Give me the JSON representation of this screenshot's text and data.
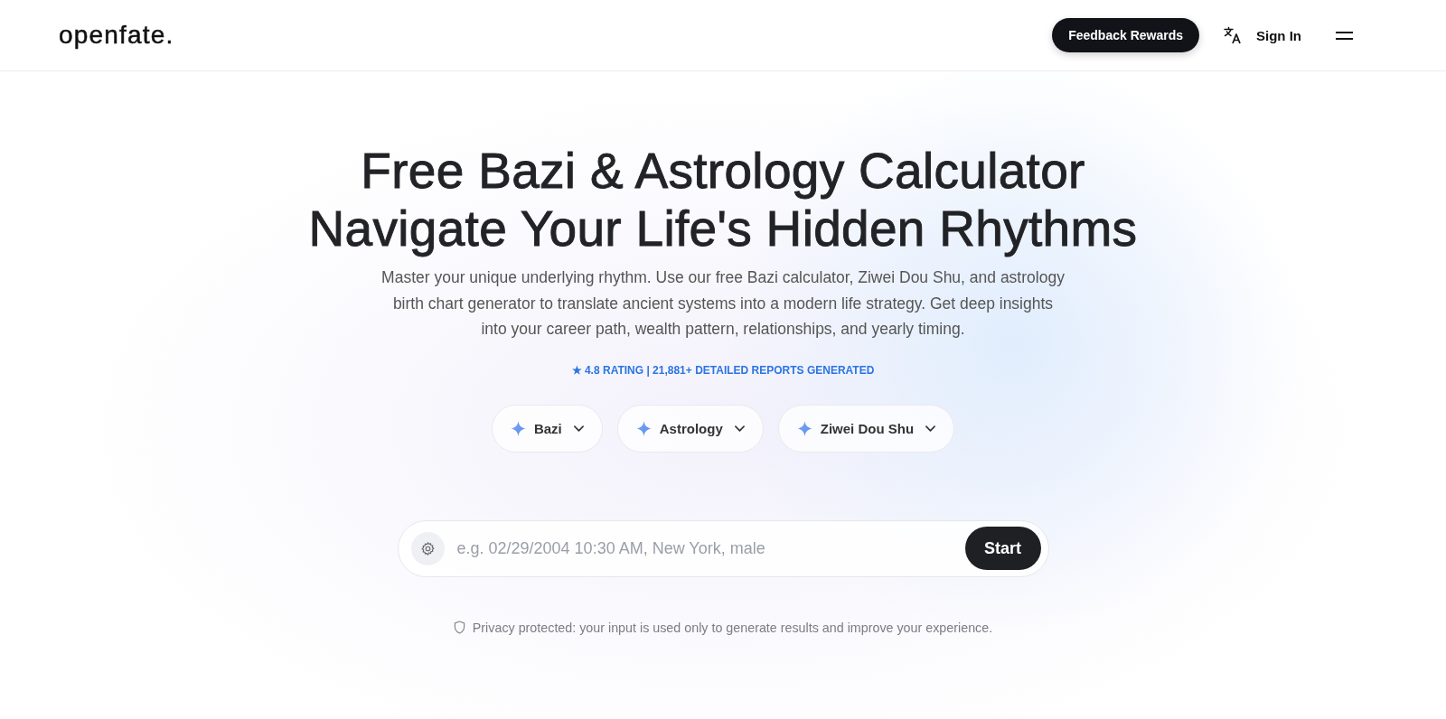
{
  "header": {
    "logo": "openfate.",
    "feedback_button": "Feedback Rewards",
    "sign_in": "Sign In"
  },
  "hero": {
    "title_lines": [
      "Free Bazi & Astrology Calculator",
      "Navigate Your Life's Hidden Rhythms"
    ],
    "description": "Master your unique underlying rhythm. Use our free Bazi calculator, Ziwei Dou Shu, and astrology birth chart generator to translate ancient systems into a modern life strategy. Get deep insights into your career path, wealth pattern, relationships, and yearly timing.",
    "rating": "★ 4.8 RATING | 21,881+ DETAILED REPORTS GENERATED"
  },
  "systems": [
    {
      "label": "Bazi"
    },
    {
      "label": "Astrology"
    },
    {
      "label": "Ziwei Dou Shu"
    }
  ],
  "search": {
    "placeholder": "e.g. 02/29/2004 10:30 AM, New York, male",
    "button": "Start"
  },
  "privacy_note": "Privacy protected: your input is used only to generate results and improve your experience."
}
